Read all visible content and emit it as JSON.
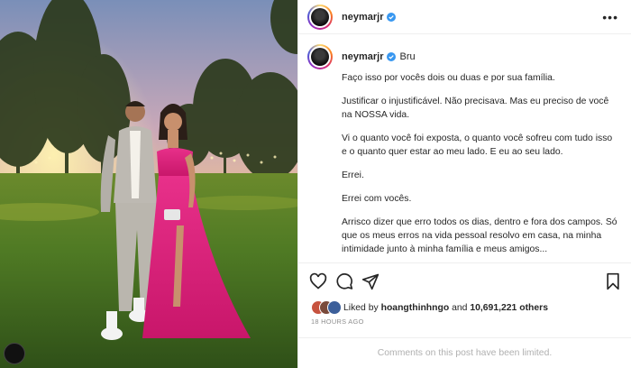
{
  "post": {
    "image_alt_icon": "photo",
    "author": {
      "username": "neymarjr",
      "verified": true,
      "avatar_icon": "profile-avatar"
    },
    "header": {
      "more_icon": "more-horizontal-icon"
    },
    "caption": {
      "first_line": "Bru",
      "paragraphs": [
        "Faço isso por vocês dois ou duas e por sua família.",
        "Justificar o injustificável. Não precisava. Mas eu preciso de você na NOSSA vida.",
        "Vi o quanto você foi exposta, o quanto você sofreu com tudo isso e o quanto quer estar ao meu lado. E eu ao seu lado.",
        "Errei.",
        "Errei com vocês.",
        "Arrisco dizer que erro todos os dias, dentro e fora dos campos. Só que os meus erros na vida pessoal resolvo em casa, na minha intimidade junto à minha família e meus amigos..."
      ]
    },
    "actions": {
      "like_icon": "heart-icon",
      "comment_icon": "comment-icon",
      "share_icon": "paper-plane-icon",
      "save_icon": "bookmark-icon"
    },
    "likes": {
      "prefix": "Liked by",
      "liker": "hoangthinhngo",
      "middle": "and",
      "count_text": "10,691,221 others"
    },
    "timestamp": "18 HOURS AGO",
    "comments_notice": "Comments on this post have been limited."
  },
  "colors": {
    "verified_blue": "#3897f0",
    "dress_pink": "#e0207a",
    "muted_text": "#8e8e8e"
  }
}
